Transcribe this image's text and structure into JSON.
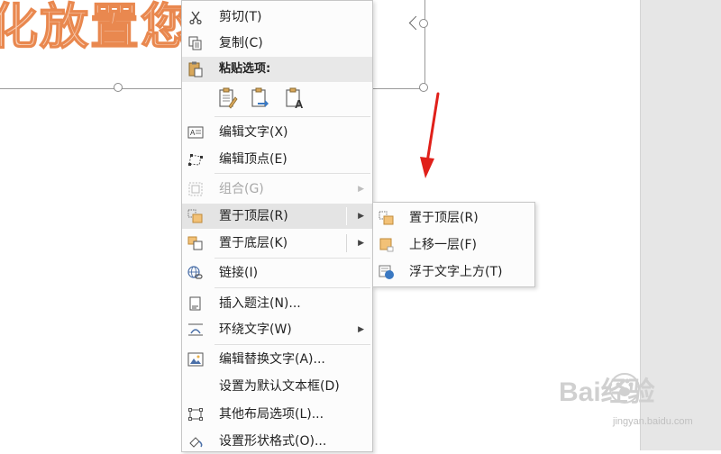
{
  "slide": {
    "textbox_text": "化放置您的字"
  },
  "menu": {
    "items": [
      {
        "label": "剪切(T)",
        "icon": "scissors-icon"
      },
      {
        "label": "复制(C)",
        "icon": "copy-icon"
      },
      {
        "label": "粘贴选项:",
        "icon": "paste-icon"
      },
      {
        "label": "编辑文字(X)",
        "icon": "edit-text-icon"
      },
      {
        "label": "编辑顶点(E)",
        "icon": "edit-points-icon"
      },
      {
        "label": "组合(G)",
        "icon": "group-icon",
        "disabled": true
      },
      {
        "label": "置于顶层(R)",
        "icon": "bring-to-front-icon"
      },
      {
        "label": "置于底层(K)",
        "icon": "send-to-back-icon"
      },
      {
        "label": "链接(I)",
        "icon": "link-icon"
      },
      {
        "label": "插入题注(N)...",
        "icon": "insert-caption-icon"
      },
      {
        "label": "环绕文字(W)",
        "icon": "wrap-text-icon"
      },
      {
        "label": "编辑替换文字(A)...",
        "icon": "alt-text-icon"
      },
      {
        "label": "设置为默认文本框(D)",
        "icon": ""
      },
      {
        "label": "其他布局选项(L)...",
        "icon": "layout-options-icon"
      },
      {
        "label": "设置形状格式(O)...",
        "icon": "format-shape-icon"
      }
    ],
    "paste_options": [
      "keep-source-formatting-icon",
      "merge-formatting-icon",
      "keep-text-only-icon"
    ]
  },
  "submenu": {
    "items": [
      {
        "label": "置于顶层(R)",
        "icon": "bring-to-front-icon"
      },
      {
        "label": "上移一层(F)",
        "icon": "bring-forward-icon"
      },
      {
        "label": "浮于文字上方(T)",
        "icon": "in-front-of-text-icon"
      }
    ]
  },
  "watermark": {
    "main": "Bai经验",
    "sub": "jingyan.baidu.com"
  },
  "colors": {
    "menu_bg": "#fcfcfc",
    "hover_bg": "#e4e4e4",
    "text_orange": "#e9884f",
    "annotation_arrow": "#e0201a"
  }
}
